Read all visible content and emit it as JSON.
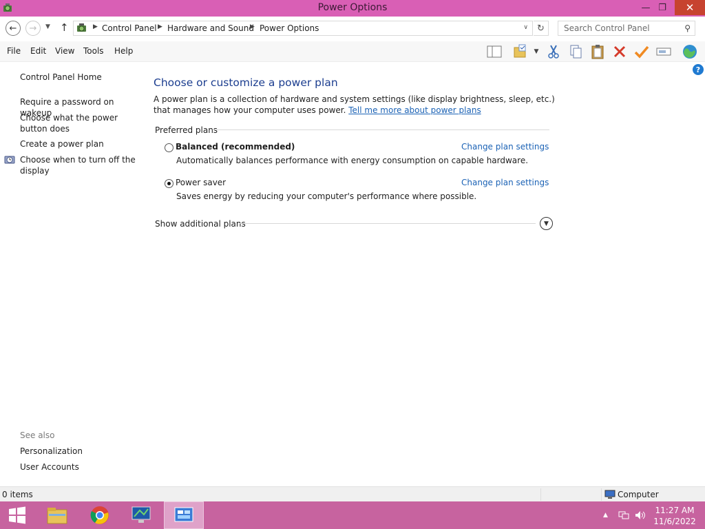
{
  "window": {
    "title": "Power Options",
    "minimize_glyph": "—",
    "maximize_glyph": "❐",
    "close_glyph": "✕"
  },
  "address": {
    "breadcrumbs": [
      "Control Panel",
      "Hardware and Sound",
      "Power Options"
    ],
    "search_placeholder": "Search Control Panel"
  },
  "menu": {
    "items": [
      "File",
      "Edit",
      "View",
      "Tools",
      "Help"
    ]
  },
  "toolbar": {
    "icons": [
      "layout-pane-icon",
      "folder-options-icon",
      "cut-icon",
      "copy-icon",
      "paste-icon",
      "delete-icon",
      "check-icon",
      "rename-icon",
      "globe-icon"
    ]
  },
  "left_pane": {
    "home": "Control Panel Home",
    "links": [
      "Require a password on wakeup",
      "Choose what the power button does",
      "Create a power plan",
      "Choose when to turn off the display"
    ],
    "see_also_label": "See also",
    "see_also": [
      "Personalization",
      "User Accounts"
    ]
  },
  "main": {
    "heading": "Choose or customize a power plan",
    "description": "A power plan is a collection of hardware and system settings (like display brightness, sleep, etc.) that manages how your computer uses power. ",
    "learn_more": "Tell me more about power plans",
    "preferred_label": "Preferred plans",
    "plans": [
      {
        "name": "Balanced (recommended)",
        "description": "Automatically balances performance with energy consumption on capable hardware.",
        "selected": false,
        "link": "Change plan settings"
      },
      {
        "name": "Power saver",
        "description": "Saves energy by reducing your computer's performance where possible.",
        "selected": true,
        "link": "Change plan settings"
      }
    ],
    "show_additional": "Show additional plans"
  },
  "status": {
    "items": "0 items",
    "zone": "Computer"
  },
  "taskbar": {
    "time": "11:27 AM",
    "date": "11/6/2022",
    "apps": [
      "file-explorer",
      "chrome",
      "remote-desktop",
      "control-panel"
    ]
  },
  "colors": {
    "titlebar": "#d95fb5",
    "taskbar": "#c7639f",
    "close_button": "#c7432f",
    "heading": "#1b3d8f",
    "link": "#1b62b5"
  }
}
